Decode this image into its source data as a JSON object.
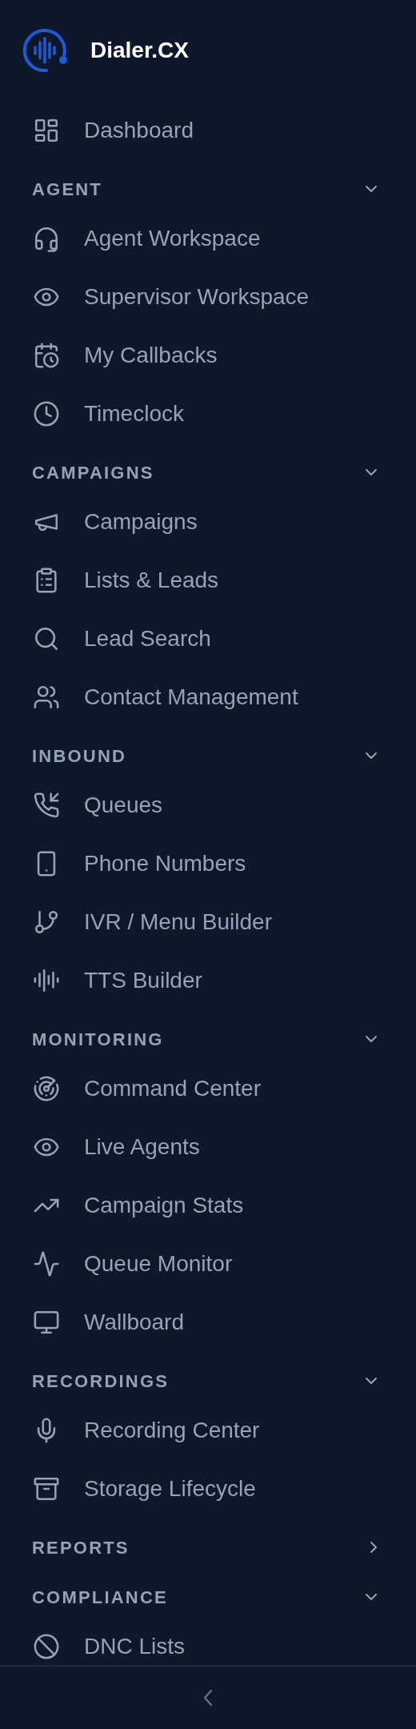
{
  "brand": {
    "name": "Dialer.CX"
  },
  "top_items": [
    {
      "label": "Dashboard"
    }
  ],
  "sections": [
    {
      "title": "AGENT",
      "expanded": true,
      "items": [
        {
          "label": "Agent Workspace"
        },
        {
          "label": "Supervisor Workspace"
        },
        {
          "label": "My Callbacks"
        },
        {
          "label": "Timeclock"
        }
      ]
    },
    {
      "title": "CAMPAIGNS",
      "expanded": true,
      "items": [
        {
          "label": "Campaigns"
        },
        {
          "label": "Lists & Leads"
        },
        {
          "label": "Lead Search"
        },
        {
          "label": "Contact Management"
        }
      ]
    },
    {
      "title": "INBOUND",
      "expanded": true,
      "items": [
        {
          "label": "Queues"
        },
        {
          "label": "Phone Numbers"
        },
        {
          "label": "IVR / Menu Builder"
        },
        {
          "label": "TTS Builder"
        }
      ]
    },
    {
      "title": "MONITORING",
      "expanded": true,
      "items": [
        {
          "label": "Command Center"
        },
        {
          "label": "Live Agents"
        },
        {
          "label": "Campaign Stats"
        },
        {
          "label": "Queue Monitor"
        },
        {
          "label": "Wallboard"
        }
      ]
    },
    {
      "title": "RECORDINGS",
      "expanded": true,
      "items": [
        {
          "label": "Recording Center"
        },
        {
          "label": "Storage Lifecycle"
        }
      ]
    },
    {
      "title": "REPORTS",
      "expanded": false
    },
    {
      "title": "COMPLIANCE",
      "expanded": true,
      "items": [
        {
          "label": "DNC Lists"
        }
      ]
    }
  ]
}
